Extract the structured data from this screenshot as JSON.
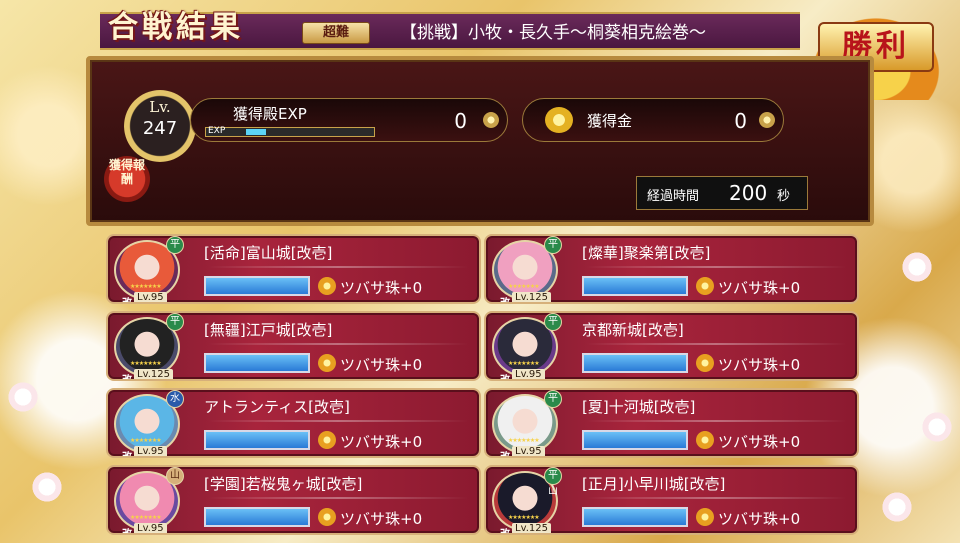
{
  "header": {
    "result_logo": "合戦結果",
    "difficulty": "超難",
    "stage_title": "【挑戦】小牧・長久手〜桐葵相克絵巻〜",
    "victory": "勝利"
  },
  "rewards": {
    "level_prefix": "Lv.",
    "level": "247",
    "exp_label": "獲得殿EXP",
    "exp_value": "0",
    "exp_bar_label": "EXP",
    "gold_label": "獲得金",
    "gold_value": "0",
    "reward_seal": "獲得報酬",
    "elapsed_label": "経過時間",
    "elapsed_value": "200",
    "elapsed_unit": "秒",
    "exp_progress": 0.12
  },
  "cards": [
    {
      "name": "[活命]富山城[改壱]",
      "level": "Lv.95",
      "type": "平",
      "orb": "ツバサ珠+0",
      "hp": 1.0
    },
    {
      "name": "[燦華]聚楽第[改壱]",
      "level": "Lv.125",
      "type": "平",
      "orb": "ツバサ珠+0",
      "hp": 1.0
    },
    {
      "name": "[無疆]江戸城[改壱]",
      "level": "Lv.125",
      "type": "平",
      "orb": "ツバサ珠+0",
      "hp": 1.0
    },
    {
      "name": "京都新城[改壱]",
      "level": "Lv.95",
      "type": "平",
      "orb": "ツバサ珠+0",
      "hp": 1.0
    },
    {
      "name": "アトランティス[改壱]",
      "level": "Lv.95",
      "type": "水",
      "orb": "ツバサ珠+0",
      "hp": 1.0
    },
    {
      "name": "[夏]十河城[改壱]",
      "level": "Lv.95",
      "type": "平",
      "orb": "ツバサ珠+0",
      "hp": 1.0
    },
    {
      "name": "[学園]若桜鬼ヶ城[改壱]",
      "level": "Lv.95",
      "type": "山",
      "orb": "ツバサ珠+0",
      "hp": 1.0
    },
    {
      "name": "[正月]小早川城[改壱]",
      "level": "Lv.125",
      "type": "平山",
      "orb": "ツバサ珠+0",
      "hp": 1.0
    }
  ],
  "card_common": {
    "upgrade_mark": "改",
    "stars": "★★★★★★★"
  }
}
